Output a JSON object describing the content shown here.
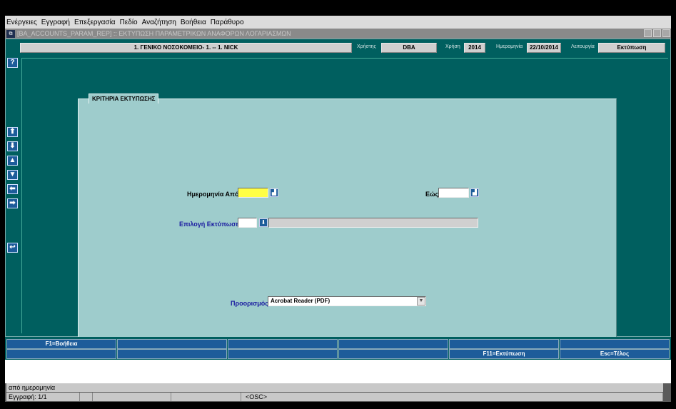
{
  "menu": [
    "Ενέργειες",
    "Εγγραφή",
    "Επεξεργασία",
    "Πεδίο",
    "Αναζήτηση",
    "Βοήθεια",
    "Παράθυρο"
  ],
  "window": {
    "title": "[BA_ACCOUNTS_PARAM_REP] :: ΕΚΤΥΠΩΣΗ ΠΑΡΑΜΕΤΡΙΚΩΝ ΑΝΑΦΟΡΩΝ ΛΟΓΑΡΙΑΣΜΩΝ"
  },
  "infobar": {
    "organization": "1. ΓΕΝΙΚΟ ΝΟΣΟΚΟΜΕΙΟ- 1. -- 1. NICK",
    "user_label": "Χρήστης",
    "user": "DBA",
    "year_label": "Χρήση",
    "year": "2014",
    "date_label": "Ημερομηνία",
    "date": "22/10/2014",
    "function_label": "Λειτουργία",
    "function": "Εκτύπωση"
  },
  "leftbar": {
    "help": "?",
    "buttons": [
      "first-record",
      "last-record",
      "previous-record",
      "next-record",
      "previous-block",
      "next-block",
      "exit"
    ]
  },
  "panel": {
    "title": "ΚΡΙΤΗΡΙΑ ΕΚΤΥΠΩΣΗΣ",
    "date_from_label": "Ημερομηνία Από",
    "date_from_value": "",
    "date_to_label": "Εώς",
    "date_to_value": "",
    "print_choice_label": "Επιλογή Εκτύπωσης",
    "print_choice_code": "",
    "print_choice_desc": "",
    "destination_label": "Προορισμός",
    "destination_value": "Acrobat Reader (PDF)"
  },
  "fkeys": {
    "row1": [
      "F1=Βοήθεια",
      "",
      "",
      "",
      "",
      ""
    ],
    "row2": [
      "",
      "",
      "",
      "",
      "F11=Εκτύπωση",
      "Esc=Τέλος"
    ]
  },
  "status": {
    "message": "από ημερομηνία",
    "record": "Εγγραφή: 1/1",
    "mode": "<OSC>"
  },
  "colors": {
    "background": "#005f5f",
    "panel": "#9ecccc",
    "required_field": "#ffff44",
    "button": "#1d5c9a"
  }
}
